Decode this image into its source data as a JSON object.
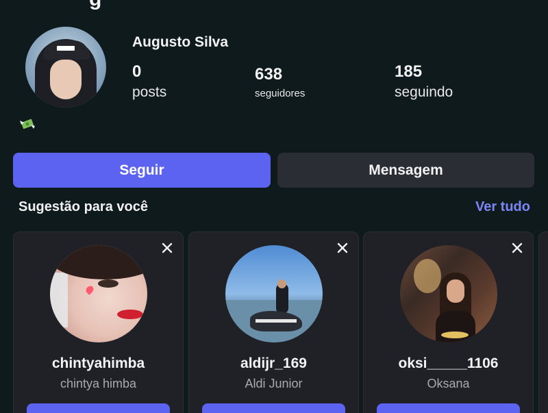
{
  "header": {
    "title_fragment": "g"
  },
  "profile": {
    "name": "Augusto Silva",
    "posts_count": "0",
    "posts_label": "posts",
    "followers_count": "638",
    "followers_label": "seguidores",
    "following_count": "185",
    "following_label": "seguindo",
    "bio_icon": "money-with-wings-icon"
  },
  "actions": {
    "follow_label": "Seguir",
    "message_label": "Mensagem"
  },
  "suggestions": {
    "title": "Sugestão para você",
    "see_all": "Ver tudo",
    "items": [
      {
        "username": "chintyahimba",
        "full_name": "chintya himba"
      },
      {
        "username": "aldijr_169",
        "full_name": "Aldi Junior"
      },
      {
        "username": "oksi_____1106",
        "full_name": "Oksana"
      }
    ]
  },
  "colors": {
    "background": "#0f1a1c",
    "primary": "#5b63f0",
    "secondary_button": "#2b2d35",
    "link": "#7d86f5",
    "card": "#1f2127"
  }
}
